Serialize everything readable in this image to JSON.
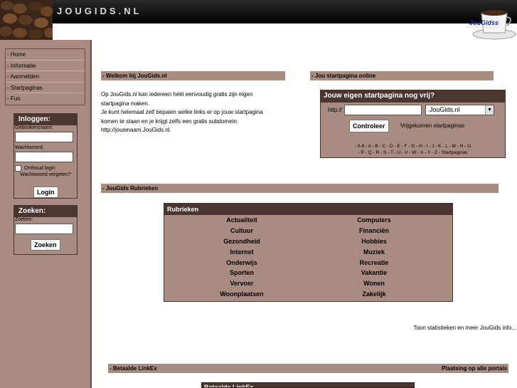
{
  "header": {
    "logo_text": "JOUGIDS.NL",
    "cup_label": "JouGidss"
  },
  "sidebar": {
    "nav": [
      "- Home",
      "- Informatie",
      "- Aanmelden",
      "- Startpaginas",
      "- Fun"
    ],
    "login": {
      "title": "Inloggen:",
      "username_label": "Gebruikersnaam:",
      "password_label": "Wachtwoord:",
      "remember_label": "Onthoud login",
      "forgot_link": "Wachtwoord vergeten?",
      "button": "Login"
    },
    "search": {
      "title": "Zoeken:",
      "label": "Zoeken:",
      "button": "Zoeken"
    }
  },
  "welcome": {
    "bar": "- Welkom bij JouGids.nl",
    "lines": [
      "Op JouGids.nl kan iedereen héél eenvoudig gratis zijn eigen",
      "startpagina maken.",
      "Je kunt helemaal zelf bepalen welke links er op jouw startpagina",
      "komen te staan en je krijgt zelfs een gratis subdomein:",
      "http://jouwnaam.JouGids.nl."
    ]
  },
  "startpagina": {
    "bar": "- Jou startpagina online",
    "box_title": "Jouw eigen startpagina nog vrij?",
    "http_label": "http://",
    "domain_value": "JouGids.nl",
    "check_button": "Controleer",
    "free_link": "Vrijgekomen startpaginas",
    "alpha_row1": "- 0-9 - A - B - C - D - E - F - G - H - I - J - K - L - M - N - O",
    "alpha_row2": "- P - Q - R - S - T - U - V - W - X - Y - Z - Startpaginas"
  },
  "rubrieken": {
    "bar": "- JouGids Rubrieken",
    "box_title": "Rubrieken",
    "left": [
      "Actualiteit",
      "Cultuur",
      "Gezondheid",
      "Internet",
      "Onderwijs",
      "Sporten",
      "Vervoer",
      "Woonplaatsen"
    ],
    "right": [
      "Computers",
      "Financiën",
      "Hobbies",
      "Muziek",
      "Recreatie",
      "Vakantie",
      "Wonen",
      "Zakelijk"
    ]
  },
  "stats_link": "Toon statistieken en meer JouGids info...",
  "linkex": {
    "bar_left": "- Betaalde LinkEx",
    "bar_right": "Plaatsing op alle portals",
    "box_title": "Betaalde LinkEx"
  },
  "colors": {
    "brown_light": "#a98c81",
    "brown_dark": "#4a3530"
  }
}
